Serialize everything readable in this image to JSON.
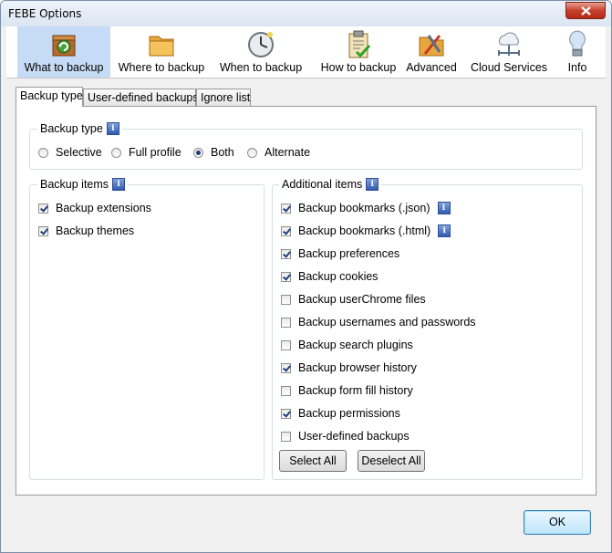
{
  "window": {
    "title": "FEBE Options",
    "close_icon": "close-icon"
  },
  "toolbar": {
    "items": [
      {
        "label": "What to backup",
        "icon": "backup-box-icon",
        "selected": true
      },
      {
        "label": "Where to backup",
        "icon": "folder-icon",
        "selected": false
      },
      {
        "label": "When to backup",
        "icon": "clock-icon",
        "selected": false
      },
      {
        "label": "How to backup",
        "icon": "clipboard-check-icon",
        "selected": false
      },
      {
        "label": "Advanced",
        "icon": "tools-icon",
        "selected": false
      },
      {
        "label": "Cloud Services",
        "icon": "cloud-network-icon",
        "selected": false
      },
      {
        "label": "Info",
        "icon": "lightbulb-icon",
        "selected": false
      }
    ]
  },
  "tabs": [
    {
      "label": "Backup type",
      "active": true
    },
    {
      "label": "User-defined backups",
      "active": false
    },
    {
      "label": "Ignore list",
      "active": false
    }
  ],
  "backup_type": {
    "title": "Backup type",
    "options": [
      {
        "label": "Selective",
        "checked": false
      },
      {
        "label": "Full profile",
        "checked": false
      },
      {
        "label": "Both",
        "checked": true
      },
      {
        "label": "Alternate",
        "checked": false
      }
    ]
  },
  "backup_items": {
    "title": "Backup items",
    "items": [
      {
        "label": "Backup extensions",
        "checked": true
      },
      {
        "label": "Backup themes",
        "checked": true
      }
    ]
  },
  "additional_items": {
    "title": "Additional items",
    "items": [
      {
        "label": "Backup bookmarks (.json)",
        "checked": true,
        "info": true
      },
      {
        "label": "Backup bookmarks (.html)",
        "checked": true,
        "info": true
      },
      {
        "label": "Backup preferences",
        "checked": true
      },
      {
        "label": "Backup cookies",
        "checked": true
      },
      {
        "label": "Backup userChrome files",
        "checked": false
      },
      {
        "label": "Backup usernames and passwords",
        "checked": false
      },
      {
        "label": "Backup search plugins",
        "checked": false
      },
      {
        "label": "Backup browser history",
        "checked": true
      },
      {
        "label": "Backup form fill history",
        "checked": false
      },
      {
        "label": "Backup permissions",
        "checked": true
      },
      {
        "label": "User-defined backups",
        "checked": false
      }
    ],
    "select_all": "Select All",
    "deselect_all": "Deselect All"
  },
  "footer": {
    "ok_label": "OK"
  },
  "info_glyph": "i"
}
